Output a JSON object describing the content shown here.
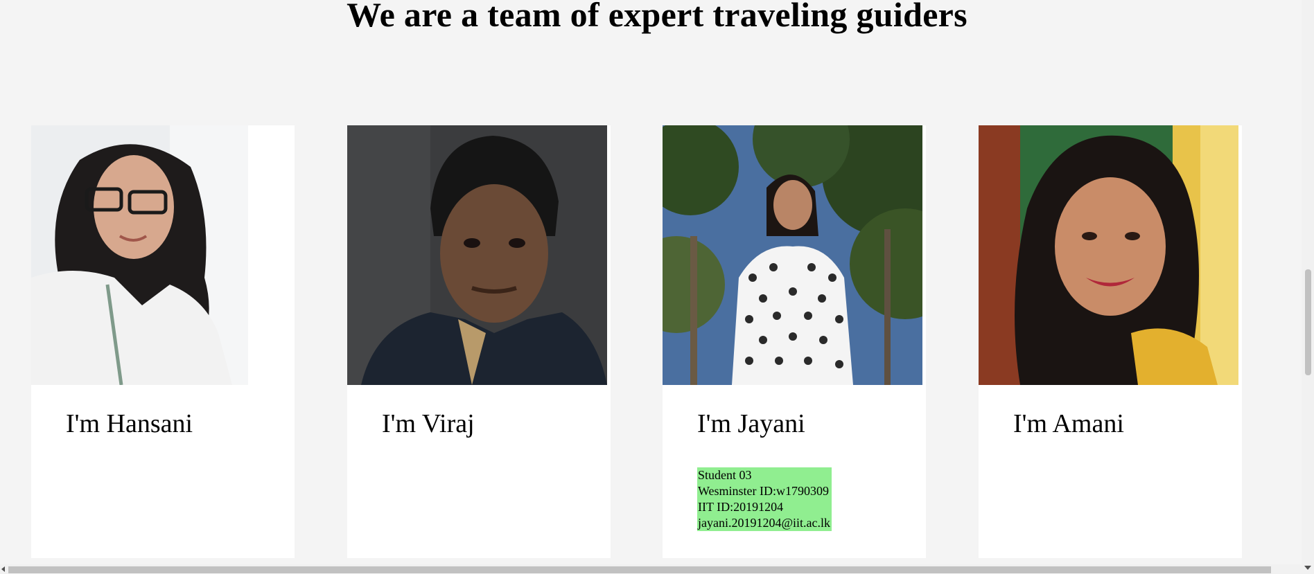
{
  "page": {
    "title": "We are a team of expert traveling guiders"
  },
  "team": [
    {
      "name": "I'm Hansani",
      "photo": "hansani-photo",
      "background": "#e9eaec"
    },
    {
      "name": "I'm Viraj",
      "photo": "viraj-photo",
      "background": "#3b3c3e"
    },
    {
      "name": "I'm Jayani",
      "photo": "jayani-photo",
      "background": "#3f5a2e",
      "info": {
        "line1": "Student 03",
        "line2": "Wesminster ID:w1790309",
        "line3": "IIT ID:20191204",
        "line4": "jayani.20191204@iit.ac.lk"
      }
    },
    {
      "name": "I'm Amani",
      "photo": "amani-photo",
      "background": "#2f6b3a"
    }
  ],
  "colors": {
    "page_background": "#f4f4f4",
    "card_background": "#ffffff",
    "info_highlight": "#90ee90"
  }
}
